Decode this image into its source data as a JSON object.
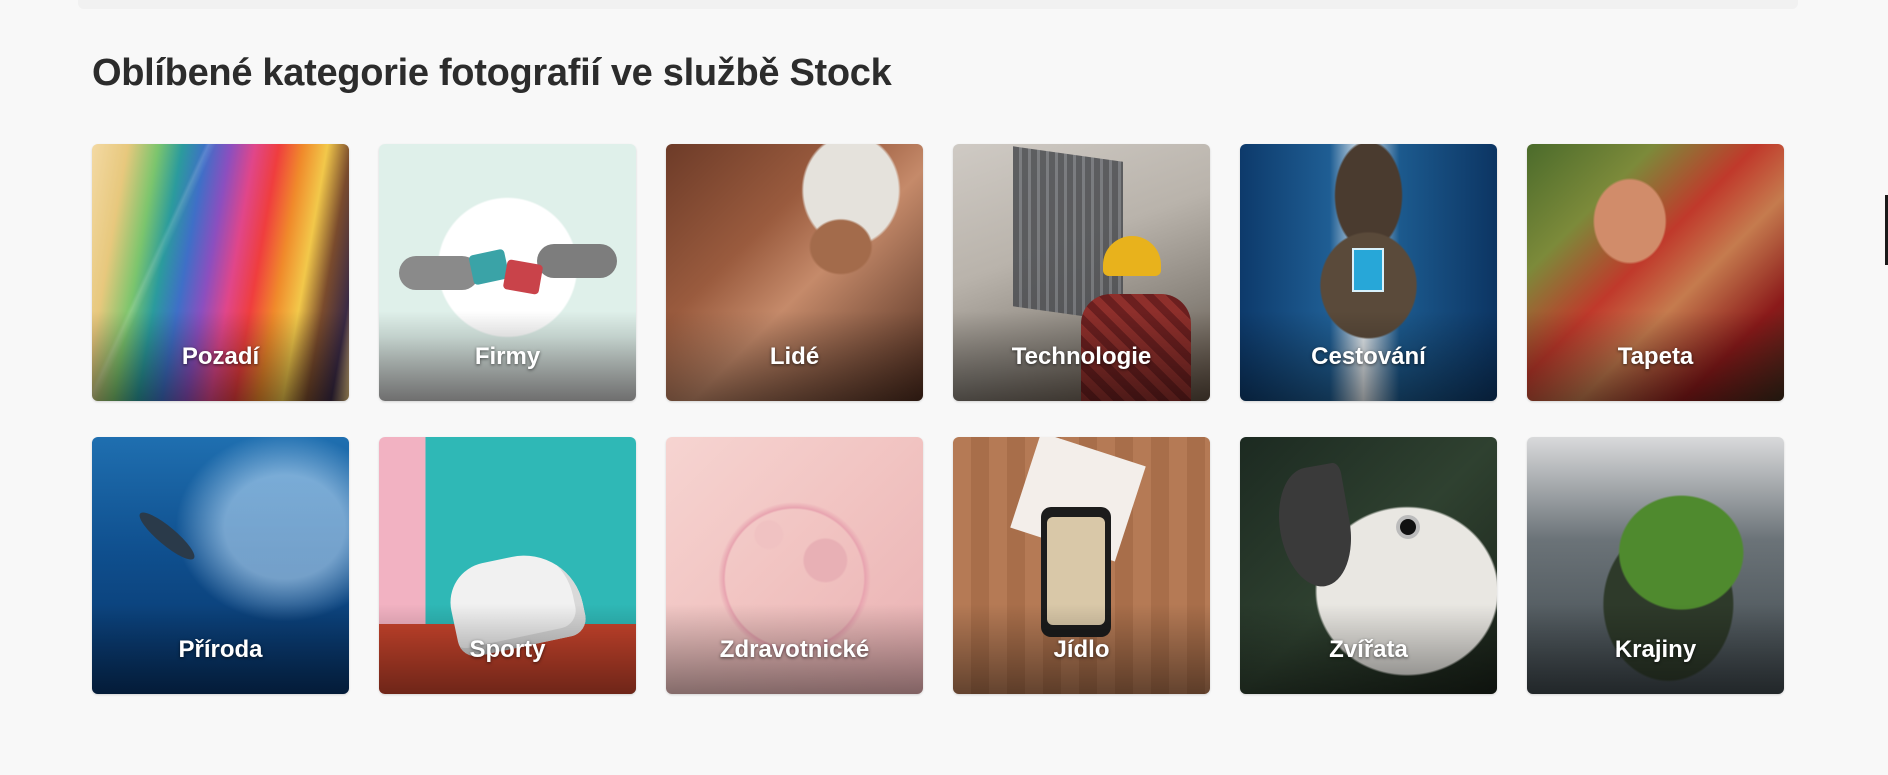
{
  "page": {
    "heading": "Oblíbené kategorie fotografií ve službě Stock"
  },
  "categories": [
    {
      "label": "Pozadí",
      "icon": "abstract-paper-waves-image"
    },
    {
      "label": "Firmy",
      "icon": "puzzle-hands-image"
    },
    {
      "label": "Lidé",
      "icon": "carnival-dancer-image"
    },
    {
      "label": "Technologie",
      "icon": "solar-panel-worker-image"
    },
    {
      "label": "Cestování",
      "icon": "aerial-coast-pool-image"
    },
    {
      "label": "Tapeta",
      "icon": "henna-hands-image"
    },
    {
      "label": "Příroda",
      "icon": "underwater-fish-image"
    },
    {
      "label": "Sporty",
      "icon": "sneaker-image"
    },
    {
      "label": "Zdravotnické",
      "icon": "petri-dish-image"
    },
    {
      "label": "Jídlo",
      "icon": "phone-food-photo-image"
    },
    {
      "label": "Zvířata",
      "icon": "cockatoo-image"
    },
    {
      "label": "Krajiny",
      "icon": "green-island-image"
    }
  ],
  "colors": {
    "background": "#f8f8f8",
    "heading": "#2c2c2c",
    "label": "#ffffff"
  }
}
